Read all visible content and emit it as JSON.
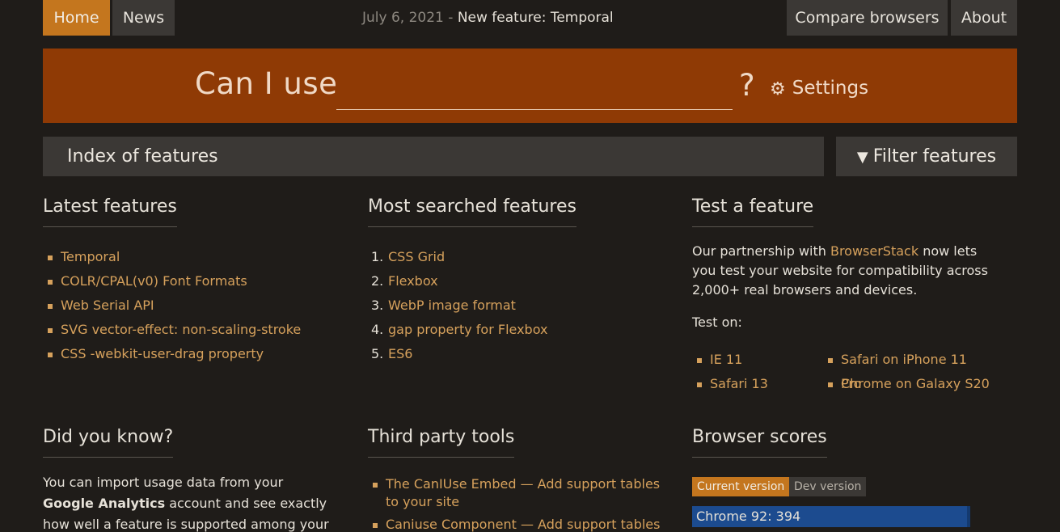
{
  "nav": {
    "home": "Home",
    "news": "News",
    "compare": "Compare browsers",
    "about": "About",
    "news_date": "July 6, 2021",
    "news_sep": "-",
    "news_title": "New feature: Temporal"
  },
  "search": {
    "label": "Can I use",
    "placeholder": "",
    "qmark": "?",
    "settings": "Settings"
  },
  "index": {
    "title": "Index of features",
    "filter": "Filter features"
  },
  "latest": {
    "heading": "Latest features",
    "items": [
      "Temporal",
      "COLR/CPAL(v0) Font Formats",
      "Web Serial API",
      "SVG vector-effect: non-scaling-stroke",
      "CSS -webkit-user-drag property"
    ]
  },
  "most": {
    "heading": "Most searched features",
    "items": [
      {
        "num": "1.",
        "label": "CSS Grid"
      },
      {
        "num": "2.",
        "label": "Flexbox"
      },
      {
        "num": "3.",
        "label": "WebP image format"
      },
      {
        "num": "4.",
        "label": "gap property for Flexbox"
      },
      {
        "num": "5.",
        "label": "ES6"
      }
    ]
  },
  "test": {
    "heading": "Test a feature",
    "text_before": "Our partnership with ",
    "link": "BrowserStack",
    "text_after": " now lets you test your website for compatibility across 2,000+ real browsers and devices.",
    "test_on": "Test on:",
    "browsers": [
      "IE 11",
      "Safari on iPhone 11 Pro",
      "Safari 13",
      "Chrome on Galaxy S20"
    ]
  },
  "know": {
    "heading": "Did you know?",
    "t1": "You can import usage data from your ",
    "b1": "Google Analytics",
    "t2": " account and see exactly how well a feature is supported among your own site's"
  },
  "tools": {
    "heading": "Third party tools",
    "items": [
      "The CanIUse Embed — Add support tables to your site",
      "Caniuse Component — Add support tables to"
    ]
  },
  "scores": {
    "heading": "Browser scores",
    "tab_current": "Current version",
    "tab_dev": "Dev version",
    "bar_label": "Chrome 92: 394"
  },
  "colors": {
    "accent": "#c4761e",
    "banner": "#8f3a05",
    "link": "#d6a15c",
    "background": "#1f1c19",
    "score_bar": "#1c4b8f"
  }
}
